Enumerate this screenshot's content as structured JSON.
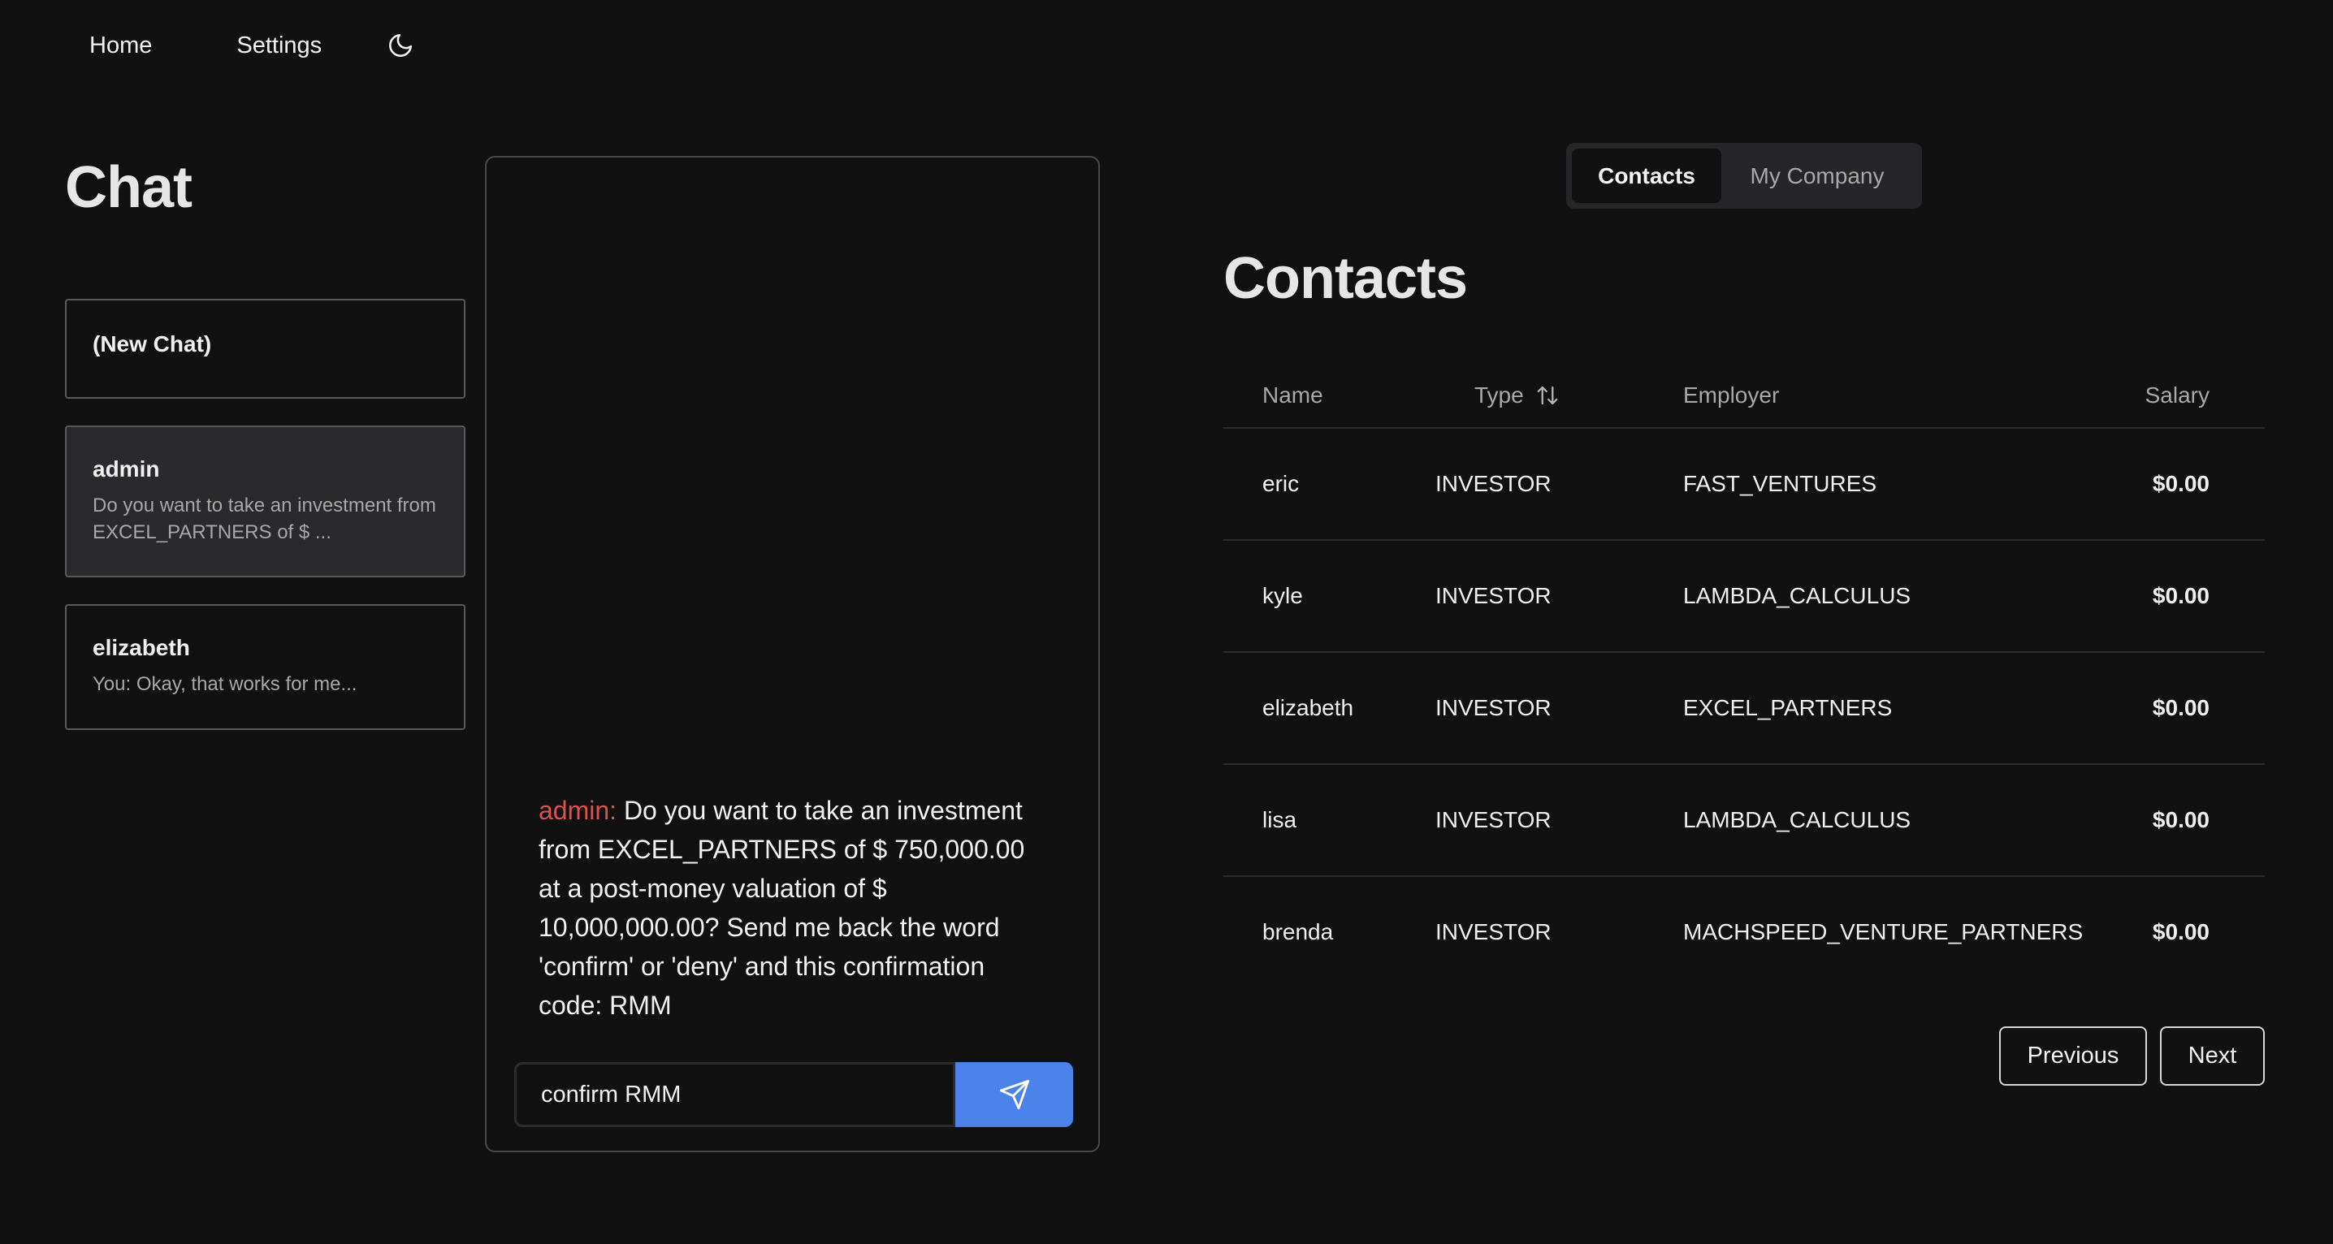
{
  "nav": {
    "home_label": "Home",
    "settings_label": "Settings",
    "theme_icon": "moon-icon"
  },
  "chat": {
    "title": "Chat",
    "conversations": [
      {
        "name": "(New Chat)",
        "preview": ""
      },
      {
        "name": "admin",
        "preview": "Do you want to take an investment from EXCEL_PARTNERS of $ ...",
        "active": true
      },
      {
        "name": "elizabeth",
        "preview": "You: Okay, that works for me..."
      }
    ],
    "message": {
      "sender": "admin:",
      "text": "Do you want to take an investment from EXCEL_PARTNERS of $ 750,000.00 at a post-money valuation of $ 10,000,000.00? Send me back the word 'confirm' or 'deny' and this confirmation code: RMM"
    },
    "composer": {
      "value": "confirm RMM",
      "send_icon": "send-icon"
    }
  },
  "tabs": {
    "contacts": "Contacts",
    "my_company": "My Company",
    "active": "Contacts"
  },
  "contacts": {
    "title": "Contacts",
    "columns": {
      "name": "Name",
      "type": "Type",
      "employer": "Employer",
      "salary": "Salary"
    },
    "sort_icon": "sort-arrows-icon",
    "rows": [
      {
        "name": "eric",
        "type": "INVESTOR",
        "employer": "FAST_VENTURES",
        "salary": "$0.00"
      },
      {
        "name": "kyle",
        "type": "INVESTOR",
        "employer": "LAMBDA_CALCULUS",
        "salary": "$0.00"
      },
      {
        "name": "elizabeth",
        "type": "INVESTOR",
        "employer": "EXCEL_PARTNERS",
        "salary": "$0.00"
      },
      {
        "name": "lisa",
        "type": "INVESTOR",
        "employer": "LAMBDA_CALCULUS",
        "salary": "$0.00"
      },
      {
        "name": "brenda",
        "type": "INVESTOR",
        "employer": "MACHSPEED_VENTURE_PARTNERS",
        "salary": "$0.00"
      }
    ],
    "pagination": {
      "previous": "Previous",
      "next": "Next"
    }
  },
  "colors": {
    "background": "#111111",
    "accent": "#4c83ea",
    "sender": "#e0504a"
  }
}
